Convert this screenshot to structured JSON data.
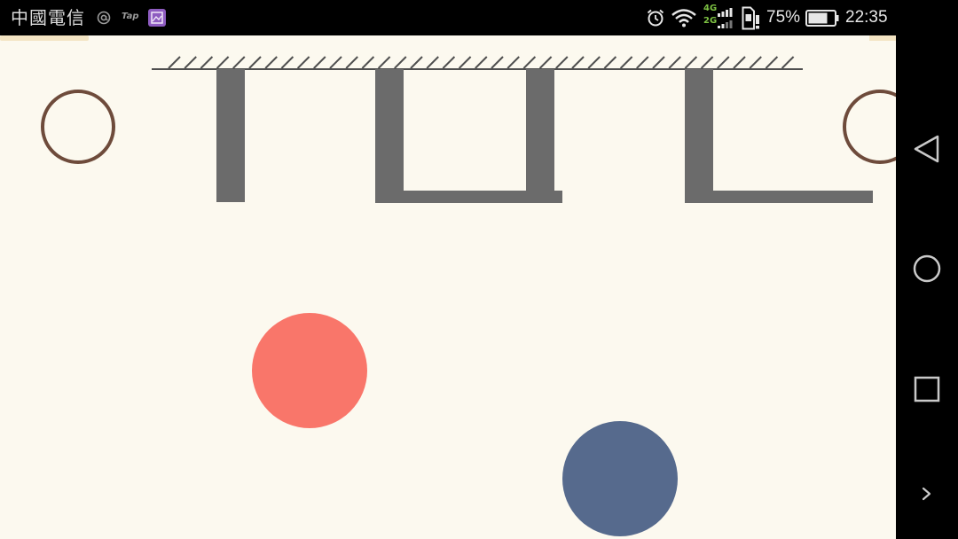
{
  "status_bar": {
    "carrier": "中國電信",
    "tap_label": "Tap",
    "network_primary": "4G",
    "network_secondary": "2G",
    "battery_label": "75%",
    "battery_level": 0.75,
    "time": "22:35",
    "icons": {
      "left": [
        "at-sign-icon",
        "tap-app-icon",
        "gallery-icon"
      ],
      "right": [
        "alarm-icon",
        "wifi-icon",
        "signal-icon",
        "sim-alert-icon",
        "battery-icon"
      ]
    }
  },
  "nav_bar": {
    "icons": [
      "back-icon",
      "home-icon",
      "recents-icon",
      "chevron-right-icon"
    ]
  },
  "game": {
    "colors": {
      "background": "#fcf9ef",
      "top_strip": "#f3e4c3",
      "ceiling": "#4f4f4f",
      "bar": "#6b6b6b",
      "target_ring": "#6e4b3b",
      "red_ball": "#f9766a",
      "blue_ball": "#566a8d"
    }
  }
}
